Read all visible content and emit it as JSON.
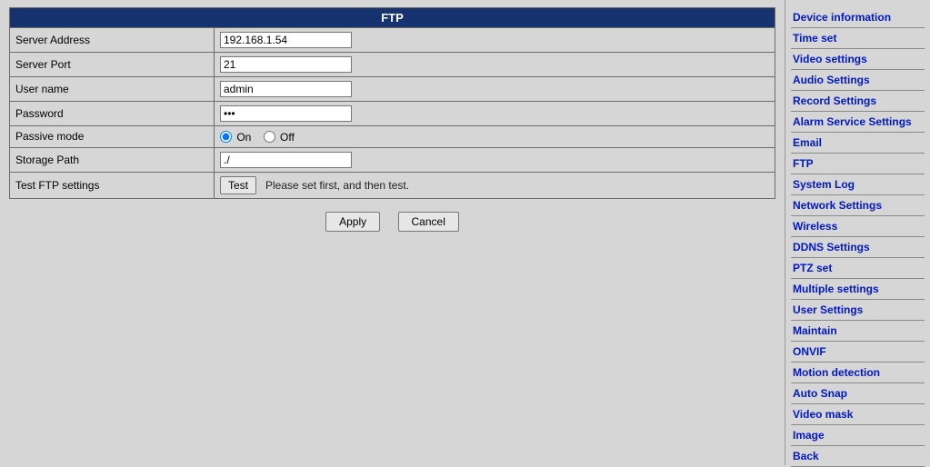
{
  "header": {
    "title": "FTP"
  },
  "form": {
    "server_address": {
      "label": "Server Address",
      "value": "192.168.1.54"
    },
    "server_port": {
      "label": "Server Port",
      "value": "21"
    },
    "user_name": {
      "label": "User name",
      "value": "admin"
    },
    "password": {
      "label": "Password",
      "value": "•••"
    },
    "passive_mode": {
      "label": "Passive mode",
      "on": "On",
      "off": "Off",
      "selected": "on"
    },
    "storage_path": {
      "label": "Storage Path",
      "value": "./"
    },
    "test_ftp": {
      "label": "Test FTP settings",
      "button": "Test",
      "hint": "Please set first, and then test."
    }
  },
  "buttons": {
    "apply": "Apply",
    "cancel": "Cancel"
  },
  "sidebar": {
    "items": [
      "Device information",
      "Time set",
      "Video settings",
      "Audio Settings",
      "Record Settings",
      "Alarm Service Settings",
      "Email",
      "FTP",
      "System Log",
      "Network Settings",
      "Wireless",
      "DDNS Settings",
      "PTZ set",
      "Multiple settings",
      "User Settings",
      "Maintain",
      "ONVIF",
      "Motion detection",
      "Auto Snap",
      "Video mask",
      "Image",
      "Back"
    ]
  }
}
